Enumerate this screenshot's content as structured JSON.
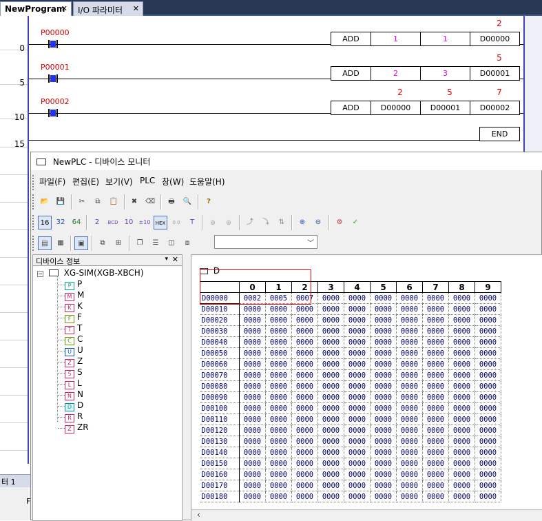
{
  "tabs": [
    {
      "label": "NewProgram",
      "active": true
    },
    {
      "label": "I/O 파라미터",
      "active": false
    }
  ],
  "ladder": {
    "step_numbers": [
      "0",
      "5",
      "10",
      "15"
    ],
    "rungs": [
      {
        "contact": "P00000",
        "func": "ADD",
        "op1": "1",
        "op2": "1",
        "dest": "D00000",
        "vals": [
          "",
          "",
          "2"
        ]
      },
      {
        "contact": "P00001",
        "func": "ADD",
        "op1": "2",
        "op2": "3",
        "dest": "D00001",
        "vals": [
          "",
          "",
          "5"
        ]
      },
      {
        "contact": "P00002",
        "func": "ADD",
        "op1": "D00000",
        "op2": "D00001",
        "dest": "D00002",
        "vals": [
          "2",
          "5",
          "7"
        ]
      }
    ],
    "end_label": "END"
  },
  "bottom_left": {
    "title": "터 1",
    "text": "F"
  },
  "monitor": {
    "title": "NewPLC - 디바이스 모니터",
    "menu": [
      "파일(F)",
      "편집(E)",
      "보기(V)",
      "PLC",
      "창(W)",
      "도움말(H)"
    ],
    "toolbar_row2": [
      "16",
      "32",
      "64"
    ],
    "tree": {
      "header": "디바이스 정보",
      "root": "XG-SIM(XGB-XBCH)",
      "items": [
        "P",
        "M",
        "K",
        "F",
        "T",
        "C",
        "U",
        "Z",
        "S",
        "L",
        "N",
        "D",
        "R",
        "ZR"
      ],
      "icon_colors": [
        "#00aa88",
        "#cc2060",
        "#cc2060",
        "#669900",
        "#cc2060",
        "#669900",
        "#0050c0",
        "#cc2060",
        "#cc2060",
        "#cc2060",
        "#cc2060",
        "#0090a0",
        "#cc2060",
        "#cc2060"
      ]
    },
    "grid": {
      "device": "D",
      "columns": [
        "0",
        "1",
        "2",
        "3",
        "4",
        "5",
        "6",
        "7",
        "8",
        "9"
      ],
      "rows": [
        {
          "addr": "D00000",
          "values": [
            "0002",
            "0005",
            "0007",
            "0000",
            "0000",
            "0000",
            "0000",
            "0000",
            "0000",
            "0000"
          ]
        },
        {
          "addr": "D00010",
          "values": [
            "0000",
            "0000",
            "0000",
            "0000",
            "0000",
            "0000",
            "0000",
            "0000",
            "0000",
            "0000"
          ]
        },
        {
          "addr": "D00020",
          "values": [
            "0000",
            "0000",
            "0000",
            "0000",
            "0000",
            "0000",
            "0000",
            "0000",
            "0000",
            "0000"
          ]
        },
        {
          "addr": "D00030",
          "values": [
            "0000",
            "0000",
            "0000",
            "0000",
            "0000",
            "0000",
            "0000",
            "0000",
            "0000",
            "0000"
          ]
        },
        {
          "addr": "D00040",
          "values": [
            "0000",
            "0000",
            "0000",
            "0000",
            "0000",
            "0000",
            "0000",
            "0000",
            "0000",
            "0000"
          ]
        },
        {
          "addr": "D00050",
          "values": [
            "0000",
            "0000",
            "0000",
            "0000",
            "0000",
            "0000",
            "0000",
            "0000",
            "0000",
            "0000"
          ]
        },
        {
          "addr": "D00060",
          "values": [
            "0000",
            "0000",
            "0000",
            "0000",
            "0000",
            "0000",
            "0000",
            "0000",
            "0000",
            "0000"
          ]
        },
        {
          "addr": "D00070",
          "values": [
            "0000",
            "0000",
            "0000",
            "0000",
            "0000",
            "0000",
            "0000",
            "0000",
            "0000",
            "0000"
          ]
        },
        {
          "addr": "D00080",
          "values": [
            "0000",
            "0000",
            "0000",
            "0000",
            "0000",
            "0000",
            "0000",
            "0000",
            "0000",
            "0000"
          ]
        },
        {
          "addr": "D00090",
          "values": [
            "0000",
            "0000",
            "0000",
            "0000",
            "0000",
            "0000",
            "0000",
            "0000",
            "0000",
            "0000"
          ]
        },
        {
          "addr": "D00100",
          "values": [
            "0000",
            "0000",
            "0000",
            "0000",
            "0000",
            "0000",
            "0000",
            "0000",
            "0000",
            "0000"
          ]
        },
        {
          "addr": "D00110",
          "values": [
            "0000",
            "0000",
            "0000",
            "0000",
            "0000",
            "0000",
            "0000",
            "0000",
            "0000",
            "0000"
          ]
        },
        {
          "addr": "D00120",
          "values": [
            "0000",
            "0000",
            "0000",
            "0000",
            "0000",
            "0000",
            "0000",
            "0000",
            "0000",
            "0000"
          ]
        },
        {
          "addr": "D00130",
          "values": [
            "0000",
            "0000",
            "0000",
            "0000",
            "0000",
            "0000",
            "0000",
            "0000",
            "0000",
            "0000"
          ]
        },
        {
          "addr": "D00140",
          "values": [
            "0000",
            "0000",
            "0000",
            "0000",
            "0000",
            "0000",
            "0000",
            "0000",
            "0000",
            "0000"
          ]
        },
        {
          "addr": "D00150",
          "values": [
            "0000",
            "0000",
            "0000",
            "0000",
            "0000",
            "0000",
            "0000",
            "0000",
            "0000",
            "0000"
          ]
        },
        {
          "addr": "D00160",
          "values": [
            "0000",
            "0000",
            "0000",
            "0000",
            "0000",
            "0000",
            "0000",
            "0000",
            "0000",
            "0000"
          ]
        },
        {
          "addr": "D00170",
          "values": [
            "0000",
            "0000",
            "0000",
            "0000",
            "0000",
            "0000",
            "0000",
            "0000",
            "0000",
            "0000"
          ]
        },
        {
          "addr": "D00180",
          "values": [
            "0000",
            "0000",
            "0000",
            "0000",
            "0000",
            "0000",
            "0000",
            "0000",
            "0000",
            "0000"
          ]
        }
      ]
    }
  }
}
